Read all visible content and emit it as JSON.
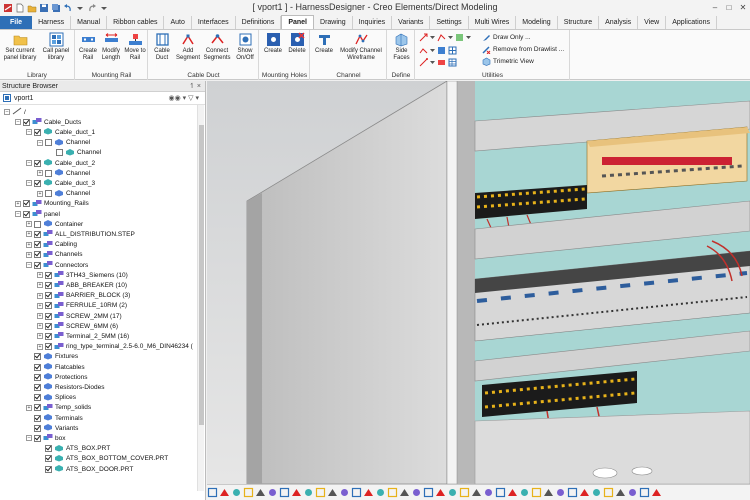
{
  "app": {
    "title": "[ vport1 ] - HarnessDesigner - Creo Elements/Direct Modeling"
  },
  "tabs": [
    "File",
    "Harness",
    "Manual",
    "Ribbon cables",
    "Auto",
    "Interfaces",
    "Definitions",
    "Panel",
    "Drawing",
    "Inquiries",
    "Variants",
    "Settings",
    "Multi Wires",
    "Modeling",
    "Structure",
    "Analysis",
    "View",
    "Applications"
  ],
  "active_tab": "Panel",
  "ribbon": {
    "library": {
      "label": "Library",
      "set_current": "Set current panel library",
      "call_panel": "Call panel library"
    },
    "mounting_rail": {
      "label": "Mounting Rail",
      "create_rail": "Create Rail",
      "modify_length": "Modify Length",
      "move_to_rail": "Move to Rail"
    },
    "cable_duct": {
      "label": "Cable Duct",
      "cable_duct": "Cable Duct",
      "add_segment": "Add Segment",
      "connect_segments": "Connect Segments",
      "show_onoff": "Show On/Off"
    },
    "mounting_holes": {
      "label": "Mounting Holes",
      "create": "Create",
      "delete": "Delete"
    },
    "channel": {
      "label": "Channel",
      "create": "Create",
      "modify_wireframe": "Modify Channel Wireframe"
    },
    "define": {
      "label": "Define",
      "side_faces": "Side Faces"
    },
    "utilities": {
      "label": "Utilities",
      "draw_only": "Draw Only ...",
      "remove_from_drawlist": "Remove from Drawlist ...",
      "trimetric_view": "Trimetric View"
    }
  },
  "browser": {
    "title": "Structure Browser",
    "viewport_selector": "vport1",
    "tree": [
      {
        "label": "/",
        "level": 0,
        "expand": "-",
        "checked": false,
        "icon": "root"
      },
      {
        "label": "Cable_Ducts",
        "level": 1,
        "expand": "-",
        "checked": true,
        "icon": "assembly"
      },
      {
        "label": "Cable_duct_1",
        "level": 2,
        "expand": "-",
        "checked": true,
        "icon": "part-teal"
      },
      {
        "label": "Channel",
        "level": 3,
        "expand": "-",
        "checked": false,
        "icon": "part-blue"
      },
      {
        "label": "Channel",
        "level": 4,
        "expand": "",
        "checked": false,
        "icon": "part-teal"
      },
      {
        "label": "Cable_duct_2",
        "level": 2,
        "expand": "-",
        "checked": true,
        "icon": "part-teal"
      },
      {
        "label": "Channel",
        "level": 3,
        "expand": "+",
        "checked": false,
        "icon": "part-blue"
      },
      {
        "label": "Cable_duct_3",
        "level": 2,
        "expand": "-",
        "checked": true,
        "icon": "part-teal"
      },
      {
        "label": "Channel",
        "level": 3,
        "expand": "+",
        "checked": false,
        "icon": "part-blue"
      },
      {
        "label": "Mounting_Rails",
        "level": 1,
        "expand": "+",
        "checked": true,
        "icon": "assembly"
      },
      {
        "label": "panel",
        "level": 1,
        "expand": "-",
        "checked": true,
        "icon": "assembly"
      },
      {
        "label": "Container",
        "level": 2,
        "expand": "+",
        "checked": false,
        "icon": "part-blue"
      },
      {
        "label": "ALL_DISTRIBUTION.STEP",
        "level": 2,
        "expand": "+",
        "checked": true,
        "icon": "assembly"
      },
      {
        "label": "Cabling",
        "level": 2,
        "expand": "+",
        "checked": true,
        "icon": "assembly"
      },
      {
        "label": "Channels",
        "level": 2,
        "expand": "+",
        "checked": true,
        "icon": "assembly"
      },
      {
        "label": "Connectors",
        "level": 2,
        "expand": "-",
        "checked": true,
        "icon": "assembly"
      },
      {
        "label": "3TH43_Siemens (10)",
        "level": 3,
        "expand": "+",
        "checked": true,
        "icon": "assembly"
      },
      {
        "label": "ABB_BREAKER (10)",
        "level": 3,
        "expand": "+",
        "checked": true,
        "icon": "assembly"
      },
      {
        "label": "BARRIER_BLOCK (3)",
        "level": 3,
        "expand": "+",
        "checked": true,
        "icon": "assembly"
      },
      {
        "label": "FERRULE_10RM (2)",
        "level": 3,
        "expand": "+",
        "checked": true,
        "icon": "assembly"
      },
      {
        "label": "SCREW_2MM (17)",
        "level": 3,
        "expand": "+",
        "checked": true,
        "icon": "assembly"
      },
      {
        "label": "SCREW_6MM (6)",
        "level": 3,
        "expand": "+",
        "checked": true,
        "icon": "assembly"
      },
      {
        "label": "Terminal_2_5MM (16)",
        "level": 3,
        "expand": "+",
        "checked": true,
        "icon": "assembly"
      },
      {
        "label": "ring_type_terminal_2.5-6.0_M6_DIN46234 (",
        "level": 3,
        "expand": "+",
        "checked": true,
        "icon": "assembly"
      },
      {
        "label": "Fixtures",
        "level": 2,
        "expand": "",
        "checked": true,
        "icon": "part-blue"
      },
      {
        "label": "Flatcables",
        "level": 2,
        "expand": "",
        "checked": true,
        "icon": "part-blue"
      },
      {
        "label": "Protections",
        "level": 2,
        "expand": "",
        "checked": true,
        "icon": "part-blue"
      },
      {
        "label": "Resistors-Diodes",
        "level": 2,
        "expand": "",
        "checked": true,
        "icon": "part-blue"
      },
      {
        "label": "Splices",
        "level": 2,
        "expand": "",
        "checked": true,
        "icon": "part-blue"
      },
      {
        "label": "Temp_solids",
        "level": 2,
        "expand": "+",
        "checked": true,
        "icon": "assembly"
      },
      {
        "label": "Terminals",
        "level": 2,
        "expand": "",
        "checked": true,
        "icon": "part-blue"
      },
      {
        "label": "Variants",
        "level": 2,
        "expand": "",
        "checked": true,
        "icon": "part-blue"
      },
      {
        "label": "box",
        "level": 2,
        "expand": "-",
        "checked": true,
        "icon": "assembly"
      },
      {
        "label": "ATS_BOX.PRT",
        "level": 3,
        "expand": "",
        "checked": true,
        "icon": "part-teal"
      },
      {
        "label": "ATS_BOX_BOTTOM_COVER.PRT",
        "level": 3,
        "expand": "",
        "checked": true,
        "icon": "part-teal"
      },
      {
        "label": "ATS_BOX_DOOR.PRT",
        "level": 3,
        "expand": "",
        "checked": true,
        "icon": "part-teal"
      }
    ]
  },
  "colors": {
    "file_tab": "#2e6fb7",
    "ribbon_bg": "#fafafa",
    "panel_back": "#a9d7d4",
    "cabinet_gray": "#d4d4d4",
    "terminal_black": "#1b1b1b",
    "terminal_yellow": "#e7b21a",
    "wire_red": "#c2302b"
  }
}
